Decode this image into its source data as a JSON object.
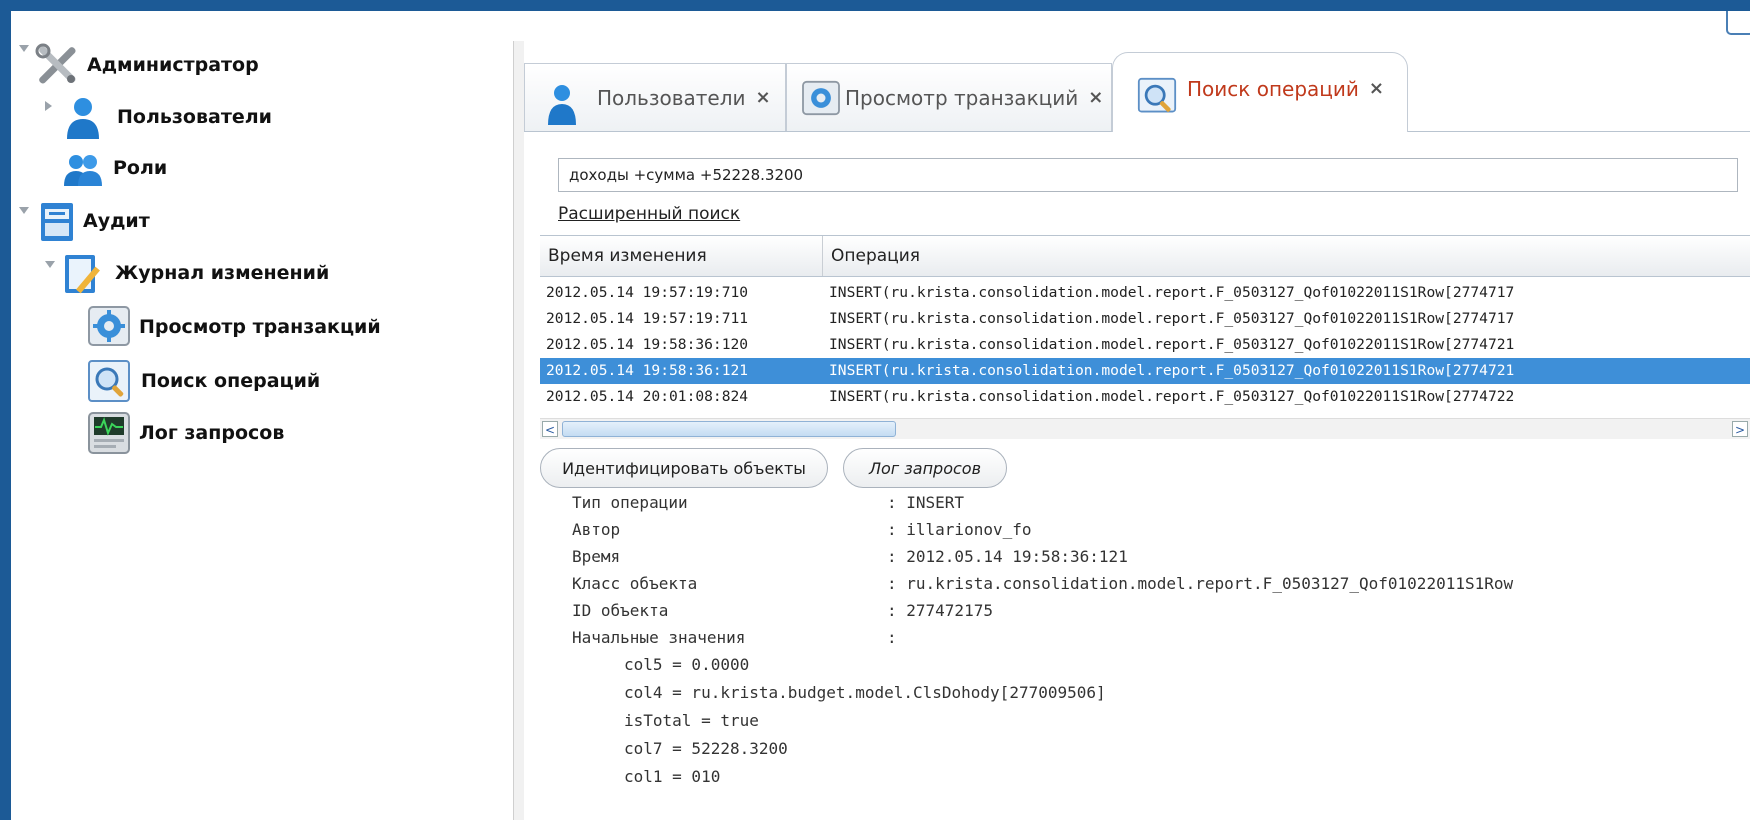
{
  "tree": {
    "items": [
      {
        "label": "Администратор",
        "icon": "tools-icon"
      },
      {
        "label": "Пользователи",
        "icon": "user-icon"
      },
      {
        "label": "Роли",
        "icon": "users-group-icon"
      },
      {
        "label": "Аудит",
        "icon": "audit-icon"
      },
      {
        "label": "Журнал изменений",
        "icon": "journal-icon"
      },
      {
        "label": "Просмотр транзакций",
        "icon": "gear-monitor-icon"
      },
      {
        "label": "Поиск операций",
        "icon": "magnifier-icon"
      },
      {
        "label": "Лог запросов",
        "icon": "log-monitor-icon"
      }
    ]
  },
  "tabs": [
    {
      "label": "Пользователи",
      "close": "×"
    },
    {
      "label": "Просмотр транзакций",
      "close": "×"
    },
    {
      "label": "Поиск операций",
      "close": "×"
    }
  ],
  "search": {
    "value": "доходы +сумма +52228.3200",
    "advanced_link": "Расширенный поиск"
  },
  "grid": {
    "columns": [
      "Время изменения",
      "Операция"
    ],
    "rows": [
      {
        "time": "2012.05.14 19:57:19:710",
        "op": "INSERT(ru.krista.consolidation.model.report.F_0503127_Qof01022011S1Row[2774717"
      },
      {
        "time": "2012.05.14 19:57:19:711",
        "op": "INSERT(ru.krista.consolidation.model.report.F_0503127_Qof01022011S1Row[2774717"
      },
      {
        "time": "2012.05.14 19:58:36:120",
        "op": "INSERT(ru.krista.consolidation.model.report.F_0503127_Qof01022011S1Row[2774721"
      },
      {
        "time": "2012.05.14 19:58:36:121",
        "op": "INSERT(ru.krista.consolidation.model.report.F_0503127_Qof01022011S1Row[2774721"
      },
      {
        "time": "2012.05.14 20:01:08:824",
        "op": "INSERT(ru.krista.consolidation.model.report.F_0503127_Qof01022011S1Row[2774722"
      }
    ],
    "selected_index": 3,
    "scroll_left": "<",
    "scroll_right": ">"
  },
  "buttons": {
    "identify": "Идентифицировать объекты",
    "log": "Лог запросов"
  },
  "details": {
    "fields": [
      {
        "key": "Тип операции",
        "value": ": INSERT"
      },
      {
        "key": "Автор",
        "value": ": illarionov_fo"
      },
      {
        "key": "Время",
        "value": ": 2012.05.14 19:58:36:121"
      },
      {
        "key": "Класс объекта",
        "value": ": ru.krista.consolidation.model.report.F_0503127_Qof01022011S1Row"
      },
      {
        "key": "ID объекта",
        "value": ": 277472175"
      },
      {
        "key": "Начальные значения",
        "value": ":"
      }
    ],
    "values": [
      "col5 = 0.0000",
      "col4 = ru.krista.budget.model.ClsDohody[277009506]",
      "isTotal = true",
      "col7 = 52228.3200",
      "col1 = 010"
    ]
  },
  "colors": {
    "frame": "#1c5a96",
    "selection": "#3e8fd8",
    "active_tab_text": "#c0391b"
  }
}
